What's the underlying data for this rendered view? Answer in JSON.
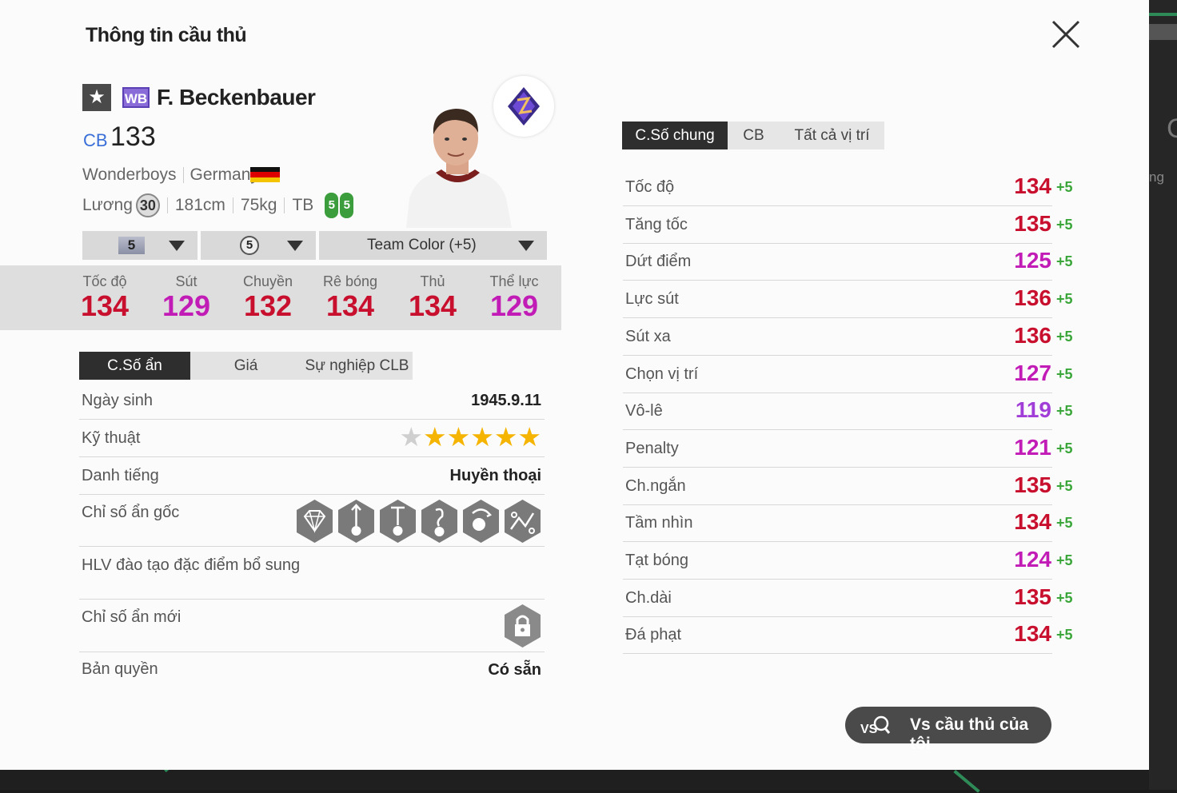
{
  "modal": {
    "title": "Thông tin cầu thủ"
  },
  "player": {
    "name": "F. Beckenbauer",
    "season_badge": "WB",
    "position": "CB",
    "overall": "133",
    "team": "Wonderboys",
    "nation": "Germany",
    "salary_label": "Lương",
    "salary": "30",
    "height": "181cm",
    "weight": "75kg",
    "body_type": "TB",
    "foot_left": "5",
    "foot_right": "5"
  },
  "selectors": {
    "level": "5",
    "training": "5",
    "team_color": "Team Color (+5)"
  },
  "main_stats": [
    {
      "label": "Tốc độ",
      "value": "134",
      "color": "#c8102e"
    },
    {
      "label": "Sút",
      "value": "129",
      "color": "#c21cb6"
    },
    {
      "label": "Chuyền",
      "value": "132",
      "color": "#c8102e"
    },
    {
      "label": "Rê bóng",
      "value": "134",
      "color": "#c8102e"
    },
    {
      "label": "Thủ",
      "value": "134",
      "color": "#c8102e"
    },
    {
      "label": "Thể lực",
      "value": "129",
      "color": "#c21cb6"
    }
  ],
  "left_tabs": [
    "C.Số ẩn",
    "Giá",
    "Sự nghiệp CLB"
  ],
  "details": {
    "birth_label": "Ngày sinh",
    "birth": "1945.9.11",
    "skill_label": "Kỹ thuật",
    "skill_stars": 5,
    "fame_label": "Danh tiếng",
    "fame": "Huyền thoại",
    "traits_label": "Chỉ số ẩn gốc",
    "traits": [
      "diamond-trait-icon",
      "long-shot-trait-icon",
      "power-header-trait-icon",
      "dribbler-trait-icon",
      "flair-trait-icon",
      "playmaker-trait-icon"
    ],
    "coach_label": "HLV đào tạo đặc điểm bổ sung",
    "new_traits_label": "Chỉ số ẩn mới",
    "license_label": "Bản quyền",
    "license": "Có sẵn"
  },
  "right_tabs": [
    "C.Số chung",
    "CB",
    "Tất cả vị trí"
  ],
  "stats": [
    {
      "label": "Tốc độ",
      "value": "134",
      "bonus": "+5",
      "color": "#c8102e"
    },
    {
      "label": "Tăng tốc",
      "value": "135",
      "bonus": "+5",
      "color": "#c8102e"
    },
    {
      "label": "Dứt điểm",
      "value": "125",
      "bonus": "+5",
      "color": "#c21cb6"
    },
    {
      "label": "Lực sút",
      "value": "136",
      "bonus": "+5",
      "color": "#c8102e"
    },
    {
      "label": "Sút xa",
      "value": "136",
      "bonus": "+5",
      "color": "#c8102e"
    },
    {
      "label": "Chọn vị trí",
      "value": "127",
      "bonus": "+5",
      "color": "#c21cb6"
    },
    {
      "label": "Vô-lê",
      "value": "119",
      "bonus": "+5",
      "color": "#a23ed8"
    },
    {
      "label": "Penalty",
      "value": "121",
      "bonus": "+5",
      "color": "#c21cb6"
    },
    {
      "label": "Ch.ngắn",
      "value": "135",
      "bonus": "+5",
      "color": "#c8102e"
    },
    {
      "label": "Tầm nhìn",
      "value": "134",
      "bonus": "+5",
      "color": "#c8102e"
    },
    {
      "label": "Tạt bóng",
      "value": "124",
      "bonus": "+5",
      "color": "#c21cb6"
    },
    {
      "label": "Ch.dài",
      "value": "135",
      "bonus": "+5",
      "color": "#c8102e"
    },
    {
      "label": "Đá phạt",
      "value": "134",
      "bonus": "+5",
      "color": "#c8102e"
    }
  ],
  "compare_button": "Vs cầu thủ của tôi",
  "background": {
    "fragment": "ng"
  }
}
